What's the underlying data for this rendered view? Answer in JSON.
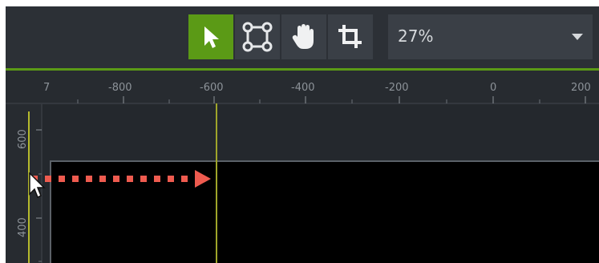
{
  "toolbar": {
    "tools": [
      {
        "name": "select-tool",
        "icon": "arrow-pointer-icon",
        "active": true
      },
      {
        "name": "edit-points-tool",
        "icon": "bounding-box-icon",
        "active": false
      },
      {
        "name": "pan-tool",
        "icon": "hand-icon",
        "active": false
      },
      {
        "name": "crop-tool",
        "icon": "crop-icon",
        "active": false
      }
    ],
    "zoom": {
      "value": "27%",
      "icon": "chevron-down-icon"
    }
  },
  "rulers": {
    "corner_label": "7",
    "horizontal": [
      "-800",
      "-600",
      "-400",
      "-200",
      "0",
      "200"
    ],
    "vertical": [
      "600",
      "400"
    ]
  },
  "colors": {
    "accent_green": "#5b9a16",
    "guide_yellow": "#b6bb2d",
    "arrow_red": "#ee5b4f",
    "background": "#272b30"
  }
}
